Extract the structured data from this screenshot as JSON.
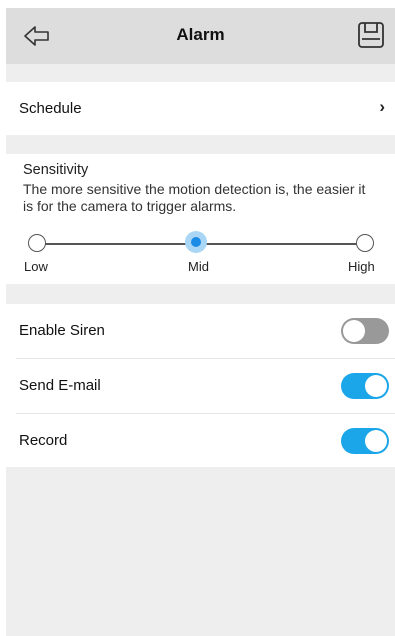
{
  "header": {
    "title": "Alarm",
    "back_icon": "back-arrow-icon",
    "save_icon": "save-icon"
  },
  "schedule": {
    "label": "Schedule",
    "chevron": "›"
  },
  "sensitivity": {
    "title": "Sensitivity",
    "description": "The more sensitive the motion detection is, the easier it is for the camera to trigger alarms.",
    "levels": [
      "Low",
      "Mid",
      "High"
    ],
    "selected": "Mid"
  },
  "toggles": [
    {
      "label": "Enable Siren",
      "on": false
    },
    {
      "label": "Send E-mail",
      "on": true
    },
    {
      "label": "Record",
      "on": true
    }
  ],
  "colors": {
    "accent": "#1aa6e8",
    "toggle_off": "#999999",
    "header_bg": "#dddddd",
    "page_bg": "#eeeeee"
  }
}
